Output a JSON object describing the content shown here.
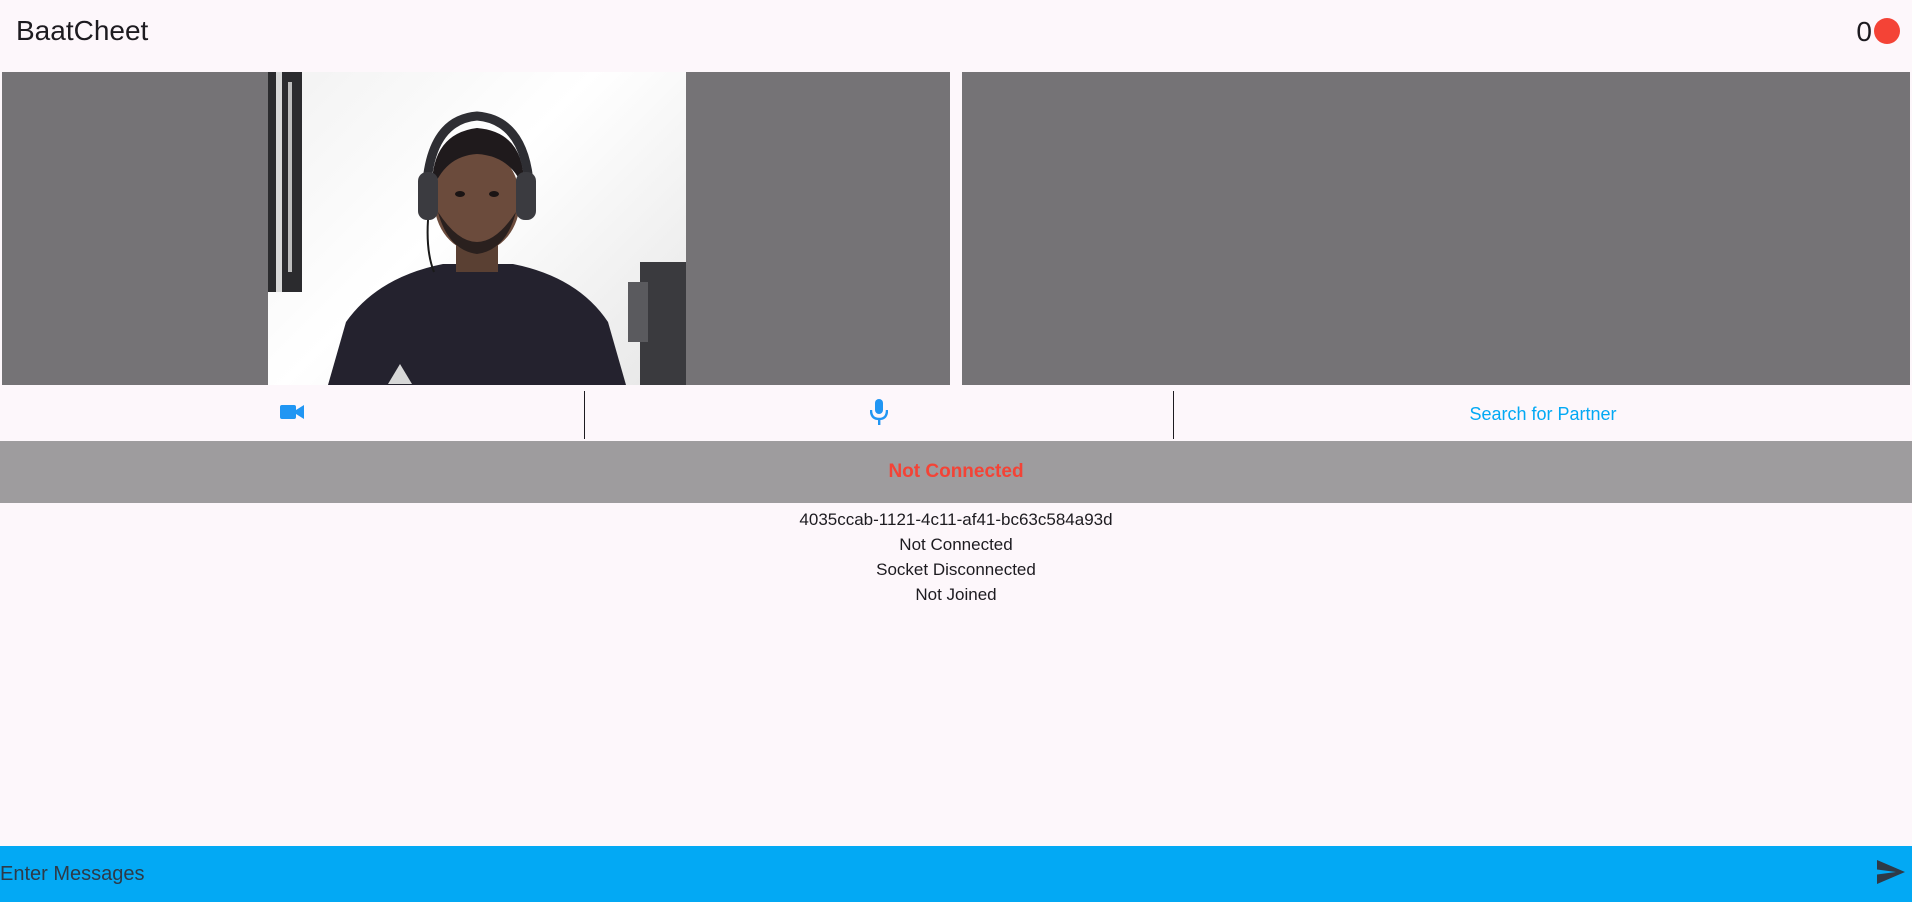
{
  "header": {
    "title": "BaatCheet",
    "online_count": "0"
  },
  "video": {
    "local_feed_icon": "webcam-person",
    "remote_feed": "empty"
  },
  "controls": {
    "camera_icon": "videocam-icon",
    "mic_icon": "mic-icon",
    "search_label": "Search for Partner"
  },
  "banner": {
    "status": "Not Connected"
  },
  "info": {
    "session_id": "4035ccab-1121-4c11-af41-bc63c584a93d",
    "connection_status": "Not Connected",
    "socket_status": "Socket Disconnected",
    "room_status": "Not Joined"
  },
  "message": {
    "placeholder": "Enter Messages",
    "send_icon": "send-icon"
  },
  "colors": {
    "accent": "#03a9f4",
    "error": "#f44336",
    "video_bg": "#757376",
    "banner_bg": "#9e9c9e",
    "background": "#fdf7fb"
  }
}
